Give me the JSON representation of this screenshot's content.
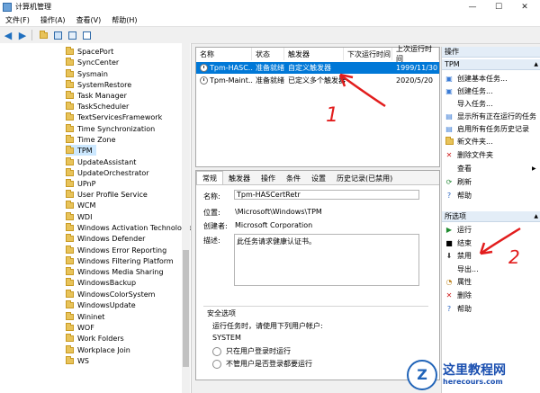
{
  "window": {
    "title": "计算机管理",
    "minimize": "—",
    "maximize": "☐",
    "close": "✕"
  },
  "menu": [
    "文件(F)",
    "操作(A)",
    "查看(V)",
    "帮助(H)"
  ],
  "tree": {
    "items": [
      "SpacePort",
      "SyncCenter",
      "Sysmain",
      "SystemRestore",
      "Task Manager",
      "TaskScheduler",
      "TextServicesFramework",
      "Time Synchronization",
      "Time Zone",
      "TPM",
      "UpdateAssistant",
      "UpdateOrchestrator",
      "UPnP",
      "User Profile Service",
      "WCM",
      "WDI",
      "Windows Activation Technologie",
      "Windows Defender",
      "Windows Error Reporting",
      "Windows Filtering Platform",
      "Windows Media Sharing",
      "WindowsBackup",
      "WindowsColorSystem",
      "WindowsUpdate",
      "Wininet",
      "WOF",
      "Work Folders",
      "Workplace Join",
      "WS"
    ],
    "selected": "TPM"
  },
  "task_table": {
    "headers": [
      "名称",
      "状态",
      "触发器",
      "下次运行时间",
      "上次运行时间"
    ],
    "rows": [
      {
        "name": "Tpm-HASC...",
        "status": "准备就绪",
        "trigger": "自定义触发器",
        "next": "",
        "last": "1999/11/30"
      },
      {
        "name": "Tpm-Maint...",
        "status": "准备就绪",
        "trigger": "已定义多个触发器",
        "next": "",
        "last": "2020/5/20"
      }
    ]
  },
  "properties": {
    "tabs": [
      "常规",
      "触发器",
      "操作",
      "条件",
      "设置",
      "历史记录(已禁用)"
    ],
    "name_label": "名称:",
    "name_value": "Tpm-HASCertRetr",
    "location_label": "位置:",
    "location_value": "\\Microsoft\\Windows\\TPM",
    "author_label": "创建者:",
    "author_value": "Microsoft Corporation",
    "desc_label": "描述:",
    "desc_value": "此任务请求健康认证书。",
    "security_title": "安全选项",
    "run_as_label": "运行任务时，请使用下列用户帐户:",
    "run_as_value": "SYSTEM",
    "option1": "只在用户登录时运行",
    "option2": "不管用户是否登录都要运行"
  },
  "actions": {
    "section1_title": "操作",
    "section1_sub": "TPM",
    "section1": [
      "创建基本任务...",
      "创建任务...",
      "导入任务...",
      "显示所有正在运行的任务",
      "启用所有任务历史记录",
      "新文件夹...",
      "删除文件夹",
      "查看",
      "刷新",
      "帮助"
    ],
    "section2_title": "所选项",
    "section2": [
      "运行",
      "结束",
      "禁用",
      "导出...",
      "属性",
      "删除",
      "帮助"
    ]
  },
  "annotations": {
    "label1": "1",
    "label2": "2"
  },
  "watermark": {
    "badge": "Z",
    "title": "这里教程网",
    "url": "herecours.com"
  }
}
